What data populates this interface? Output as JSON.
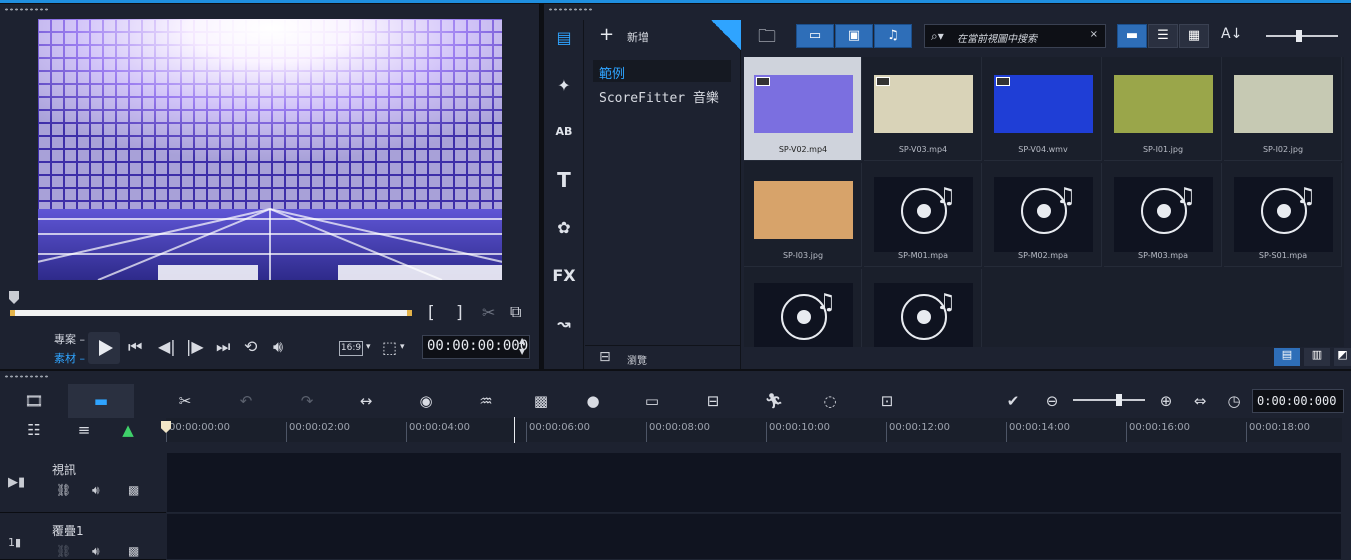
{
  "preview": {
    "mode_project": "專案",
    "mode_clip": "素材",
    "aspect": "16:9",
    "timecode": "00:00:00:000"
  },
  "library": {
    "add_label": "新增",
    "folders": [
      "範例",
      "ScoreFitter 音樂"
    ],
    "browse_label": "瀏覽",
    "search_placeholder": "在當前視圖中搜索",
    "category_icons": [
      "media-icon",
      "transition-icon",
      "title-icon",
      "text-icon",
      "graphic-icon",
      "filter-icon",
      "path-icon"
    ],
    "fx_label": "FX",
    "items": [
      {
        "name": "SP-V02.mp4",
        "type": "video",
        "color": "#7b6fe0",
        "selected": true
      },
      {
        "name": "SP-V03.mp4",
        "type": "video",
        "color": "#d9d3b8"
      },
      {
        "name": "SP-V04.wmv",
        "type": "video",
        "color": "#1f3ed6"
      },
      {
        "name": "SP-I01.jpg",
        "type": "image",
        "color": "#9aa64a"
      },
      {
        "name": "SP-I02.jpg",
        "type": "image",
        "color": "#c6c9b3"
      },
      {
        "name": "SP-I03.jpg",
        "type": "image",
        "color": "#d7a36a"
      },
      {
        "name": "SP-M01.mpa",
        "type": "audio"
      },
      {
        "name": "SP-M02.mpa",
        "type": "audio"
      },
      {
        "name": "SP-M03.mpa",
        "type": "audio"
      },
      {
        "name": "SP-S01.mpa",
        "type": "audio"
      },
      {
        "name": "",
        "type": "audio"
      },
      {
        "name": "",
        "type": "audio"
      }
    ]
  },
  "timeline": {
    "timecode": "0:00:00:000",
    "ruler": [
      "00:00:00:00",
      "00:00:02:00",
      "00:00:04:00",
      "00:00:06:00",
      "00:00:08:00",
      "00:00:10:00",
      "00:00:12:00",
      "00:00:14:00",
      "00:00:16:00",
      "00:00:18:00"
    ],
    "tracks": [
      {
        "name": "視訊"
      },
      {
        "name": "覆疊1"
      }
    ]
  },
  "colors": {
    "accent": "#1f8fe0",
    "panel": "#1d2230"
  }
}
